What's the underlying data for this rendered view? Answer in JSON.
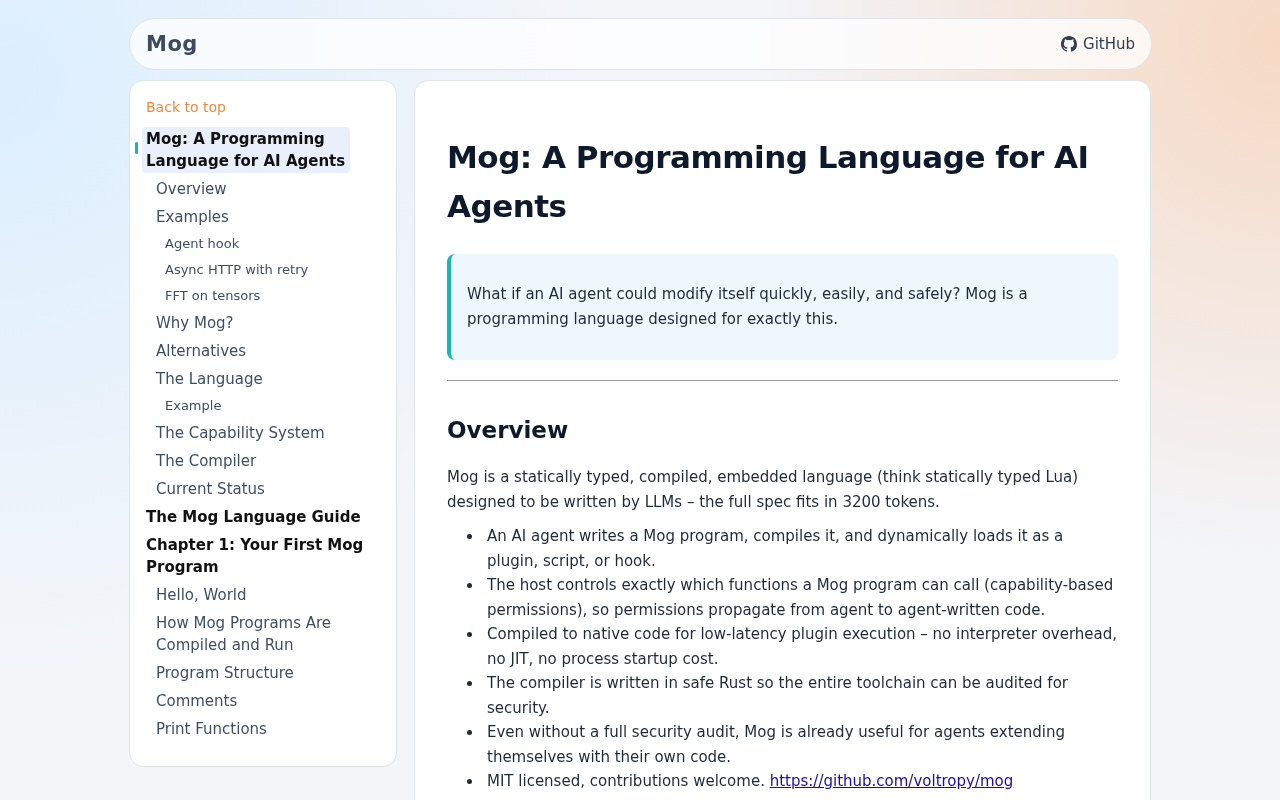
{
  "header": {
    "title": "Mog",
    "github_link": "GitHub"
  },
  "sidebar": {
    "back_link": "Back to top",
    "toc": [
      {
        "label": "Mog: A Programming Language for AI Agents",
        "selected": true,
        "children": [
          {
            "label": "Overview",
            "selected": false
          },
          {
            "label": "Examples",
            "selected": false,
            "children": [
              {
                "label": "Agent hook",
                "selected": false
              },
              {
                "label": "Async HTTP with retry",
                "selected": false
              },
              {
                "label": "FFT on tensors",
                "selected": false
              }
            ]
          },
          {
            "label": "Why Mog?",
            "selected": false
          },
          {
            "label": "Alternatives",
            "selected": false
          },
          {
            "label": "The Language",
            "selected": false,
            "children": [
              {
                "label": "Example",
                "selected": false
              }
            ]
          },
          {
            "label": "The Capability System",
            "selected": false
          },
          {
            "label": "The Compiler",
            "selected": false
          },
          {
            "label": "Current Status",
            "selected": false
          }
        ]
      },
      {
        "label": "The Mog Language Guide",
        "selected": false
      },
      {
        "label": "Chapter 1: Your First Mog Program",
        "selected": false,
        "children": [
          {
            "label": "Hello, World",
            "selected": false
          },
          {
            "label": "How Mog Programs Are Compiled and Run",
            "selected": false
          },
          {
            "label": "Program Structure",
            "selected": false
          },
          {
            "label": "Comments",
            "selected": false
          },
          {
            "label": "Print Functions",
            "selected": false
          }
        ]
      }
    ]
  },
  "article": {
    "title": "Mog: A Programming Language for AI Agents",
    "callout": "What if an AI agent could modify itself quickly, easily, and safely? Mog is a programming language designed for exactly this.",
    "section_heading": "Overview",
    "paragraph": "Mog is a statically typed, compiled, embedded language (think statically typed Lua) designed to be written by LLMs – the full spec fits in 3200 tokens.",
    "bullets": [
      {
        "text": "An AI agent writes a Mog program, compiles it, and dynamically loads it as a plugin, script, or hook."
      },
      {
        "text": "The host controls exactly which functions a Mog program can call (capability-based permissions), so permissions propagate from agent to agent-written code."
      },
      {
        "text": "Compiled to native code for low-latency plugin execution – no interpreter overhead, no JIT, no process startup cost."
      },
      {
        "text": "The compiler is written in safe Rust so the entire toolchain can be audited for security."
      },
      {
        "text": "Even without a full security audit, Mog is already useful for agents extending themselves with their own code."
      },
      {
        "text": "MIT licensed, contributions welcome.",
        "link": "https://github.com/voltropy/mog"
      }
    ]
  }
}
